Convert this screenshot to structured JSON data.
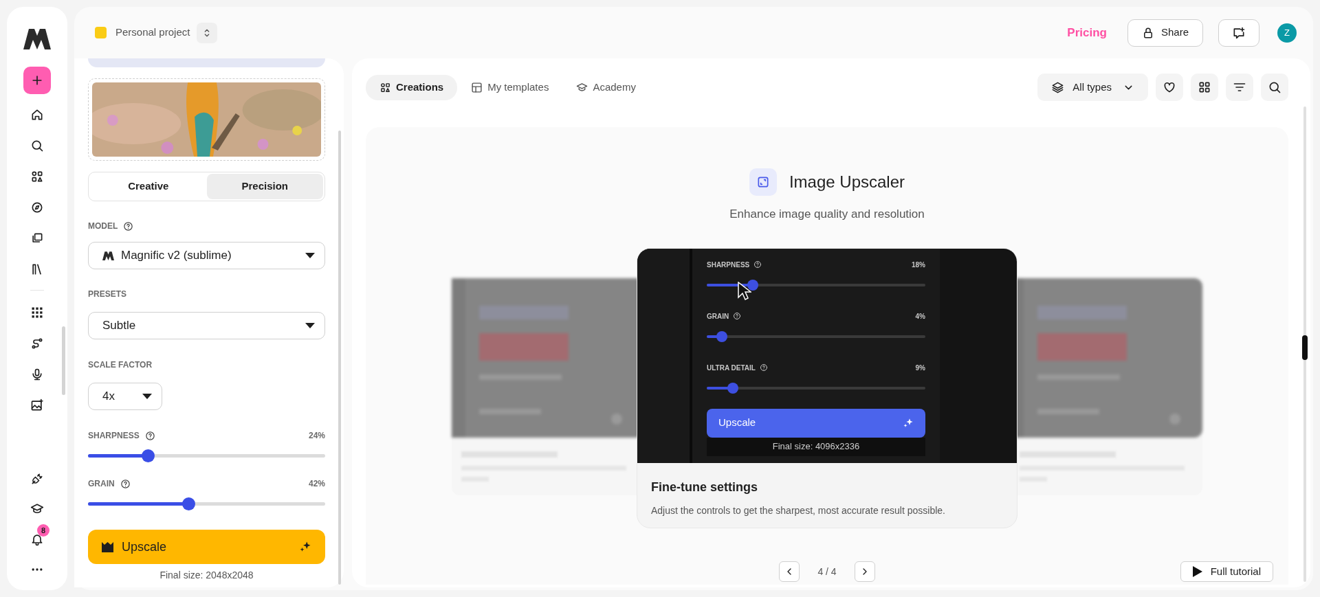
{
  "project": {
    "name": "Personal project"
  },
  "rail": {
    "notifications": "8"
  },
  "header": {
    "pricing": "Pricing",
    "share": "Share",
    "avatar": "Z"
  },
  "panel": {
    "modes": [
      {
        "label": "Creative",
        "selected": false
      },
      {
        "label": "Precision",
        "selected": true
      }
    ],
    "model": {
      "label": "MODEL",
      "value": "Magnific v2 (sublime)"
    },
    "presets": {
      "label": "PRESETS",
      "value": "Subtle"
    },
    "scale_factor": {
      "label": "SCALE FACTOR",
      "value": "4x"
    },
    "sliders": [
      {
        "label": "SHARPNESS",
        "reading": "24%",
        "level": 0.24
      },
      {
        "label": "GRAIN",
        "reading": "42%",
        "level": 0.42
      }
    ],
    "upscale_button": "Upscale",
    "final_size": "Final size: 2048x2048"
  },
  "content": {
    "tabs": [
      {
        "label": "Creations",
        "selected": true
      },
      {
        "label": "My templates",
        "selected": false
      },
      {
        "label": "Academy",
        "selected": false
      }
    ],
    "type_filter": "All types",
    "tool": {
      "title": "Image Upscaler",
      "subtitle": "Enhance image quality and resolution"
    },
    "slide": {
      "sliders": [
        {
          "label": "SHARPNESS",
          "reading": "18%",
          "level": 0.18
        },
        {
          "label": "GRAIN",
          "reading": "4%",
          "level": 0.04
        },
        {
          "label": "ULTRA DETAIL",
          "reading": "9%",
          "level": 0.09
        }
      ],
      "button": "Upscale",
      "final_size": "Final size: 4096x2336",
      "title": "Fine-tune settings",
      "text": "Adjust the controls to get the sharpest, most accurate result possible."
    },
    "pagination": "4 / 4",
    "tutorial_button": "Full tutorial"
  }
}
